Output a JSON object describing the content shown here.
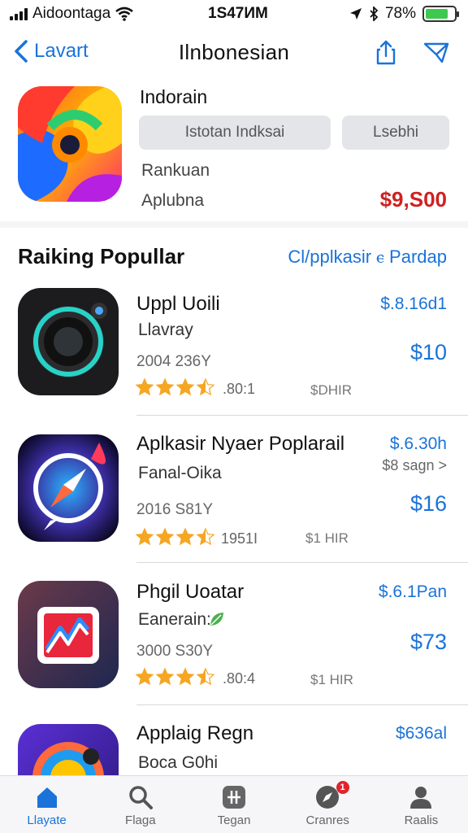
{
  "status_bar": {
    "carrier": "Aidoontaga",
    "time": "1S47ИM",
    "battery": "78%",
    "battery_level": 0.78
  },
  "nav": {
    "back_label": "Lavart",
    "title": "Ilnbonesian"
  },
  "featured": {
    "name": "Indorain",
    "button_primary": "Istotan Indksai",
    "button_secondary": "Lsebhi",
    "rank": "Rankuan",
    "subtitle": "Aplubna",
    "price": "$9,S00"
  },
  "section": {
    "title": "Raiking Popullar",
    "link": "Cl/pplkasir ⲉ Pardap"
  },
  "apps": [
    {
      "name": "Uppl Uoili",
      "developer": "Llavray",
      "date": "2004 236Y",
      "stars": 3.5,
      "rating_text": ".80:1",
      "size": "$DHIR",
      "price_small": "$.8.16d1",
      "price_large": "$10",
      "extra": "",
      "icon": "camera-lens-icon"
    },
    {
      "name": "Aplkasir Nyaer Poplarail",
      "developer": "Fanal-Oika",
      "date": "2016 S81Y",
      "stars": 3.5,
      "rating_text": "1951I",
      "size": "$1 HIR",
      "price_small": "$.6.30h",
      "price_large": "$16",
      "extra": "$8 sagn >",
      "icon": "compass-icon"
    },
    {
      "name": "Phgil Uoatar",
      "developer": "Eanerain:",
      "date": "3000 S30Y",
      "stars": 3.5,
      "rating_text": ".80:4",
      "size": "$1 HIR",
      "price_small": "$.6.1Pan",
      "price_large": "$73",
      "extra": "",
      "icon": "chart-card-icon"
    },
    {
      "name": "Applaig Regn",
      "developer": "Boca G0hi",
      "date": "",
      "stars": 0,
      "rating_text": "",
      "size": "",
      "price_small": "$636al",
      "price_large": "",
      "extra": "",
      "icon": "globe-camera-icon"
    }
  ],
  "tabs": [
    {
      "label": "Llayate",
      "icon": "home-icon",
      "active": true
    },
    {
      "label": "Flaga",
      "icon": "search-icon",
      "active": false
    },
    {
      "label": "Tegan",
      "icon": "plus-square-icon",
      "active": false
    },
    {
      "label": "Cranres",
      "icon": "compass-icon",
      "active": false,
      "badge": "1"
    },
    {
      "label": "Raalis",
      "icon": "person-icon",
      "active": false
    }
  ],
  "colors": {
    "accent": "#1a73d9",
    "price_red": "#d02020",
    "star": "#f5a623",
    "badge": "#e0242b"
  }
}
